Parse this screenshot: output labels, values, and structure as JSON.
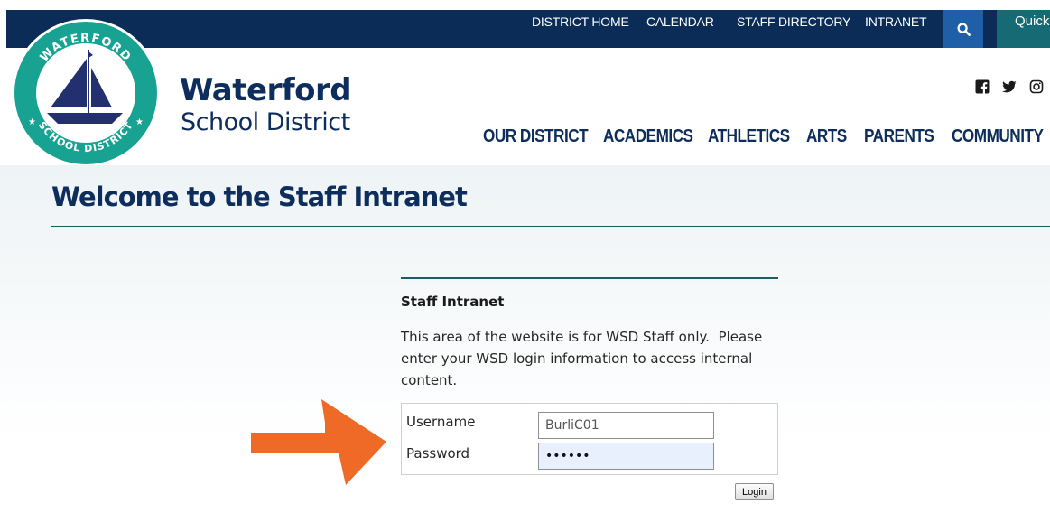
{
  "topbar": {
    "links": [
      "DISTRICT HOME",
      "CALENDAR",
      "STAFF DIRECTORY",
      "INTRANET"
    ],
    "quick_label": "Quick"
  },
  "brand": {
    "name": "Waterford",
    "subtitle": "School District",
    "logo_ring_top": "WATERFORD",
    "logo_ring_bottom": "SCHOOL DISTRICT"
  },
  "social": [
    "facebook-icon",
    "twitter-icon",
    "instagram-icon"
  ],
  "mainnav": [
    "OUR DISTRICT",
    "ACADEMICS",
    "ATHLETICS",
    "ARTS",
    "PARENTS",
    "COMMUNITY"
  ],
  "page": {
    "title": "Welcome to the Staff Intranet"
  },
  "panel": {
    "heading": "Staff Intranet",
    "description": "This area of the website is for WSD Staff only.  Please enter your WSD login information to access internal content."
  },
  "form": {
    "username_label": "Username",
    "username_value": "BurliC01",
    "password_label": "Password",
    "password_value": "••••••",
    "login_label": "Login"
  },
  "colors": {
    "navy": "#0a2c57",
    "search_blue": "#1f5fa8",
    "teal": "#166a73",
    "logo_teal": "#17a292",
    "arrow_orange": "#ef6a27"
  }
}
